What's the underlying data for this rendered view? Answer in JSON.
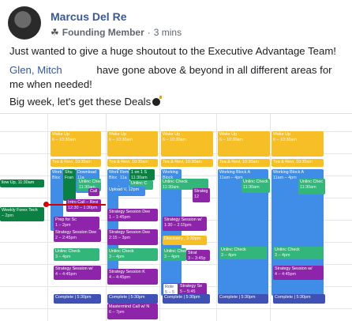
{
  "post": {
    "author": "Marcus Del Re",
    "role": "Founding Member",
    "separator": "·",
    "time": "3 mins",
    "line1": "Just wanted to give a huge shoutout to the Executive Advantage Team!",
    "mention1": "Glen,",
    "mention2": "Mitch",
    "line2a": "have gone above & beyond in all different areas for",
    "line2b": "me when needed!",
    "line3": "Big week, let's get these Deals",
    "icons": {
      "badge": "sprout-icon",
      "emoji": "bomb-icon"
    }
  },
  "calendar": {
    "colors": {
      "yellow": "#f6bf26",
      "blue": "#3f8de6",
      "purple": "#8e24aa",
      "green": "#33b679",
      "navy": "#3f51b5",
      "teal": "#0b8043",
      "now": "#d50000"
    },
    "events": [
      {
        "t": "Wake Up",
        "s": "6 – 10:30am",
        "c": "yellow"
      },
      {
        "t": "Wake Up",
        "s": "6 – 10:30am",
        "c": "yellow"
      },
      {
        "t": "Wake Up",
        "s": "6 – 10:30am",
        "c": "yellow"
      },
      {
        "t": "Wake Up",
        "s": "6 – 10:30am",
        "c": "yellow"
      },
      {
        "t": "Wake Up",
        "s": "6 – 10:30am",
        "c": "yellow"
      },
      {
        "t": "Tea & Revi, 10:30am",
        "s": "",
        "c": "yellow"
      },
      {
        "t": "Tea & Revi, 10:30am",
        "s": "",
        "c": "yellow"
      },
      {
        "t": "Tea & Revi, 10:30am",
        "s": "",
        "c": "yellow"
      },
      {
        "t": "Tea & Revi, 10:30am",
        "s": "",
        "c": "yellow"
      },
      {
        "t": "Tea & Revi, 10:30am",
        "s": "",
        "c": "yellow"
      },
      {
        "t": "llow Up, 11:30am",
        "s": "",
        "c": "teal"
      },
      {
        "t": "Weekly Forex Tech",
        "s": "– 2pm",
        "c": "teal"
      },
      {
        "t": "Work",
        "s": "Bloc",
        "c": "blue"
      },
      {
        "t": "Shu",
        "s": "Fran",
        "c": "teal"
      },
      {
        "t": "Download",
        "s": "11a",
        "c": "blue"
      },
      {
        "t": "Unlinc Chec",
        "s": "11:30am",
        "c": "green"
      },
      {
        "t": "Call",
        "s": "",
        "c": "purple"
      },
      {
        "t": "Intro Call – Revi",
        "s": "12:30 – 1:30pm",
        "c": "purple"
      },
      {
        "t": "Prep for Sc",
        "s": "1 – 2pm",
        "c": "purple"
      },
      {
        "t": "Strategy Session Dee",
        "s": "2 – 2:45pm",
        "c": "purple"
      },
      {
        "t": "Unlinc Check",
        "s": "3 – 4pm",
        "c": "green"
      },
      {
        "t": "Strategy Session w/",
        "s": "4 – 4:45pm",
        "c": "purple"
      },
      {
        "t": "Complete | 5:30pm",
        "s": "",
        "c": "navy"
      },
      {
        "t": "Work",
        "s": "Bloc",
        "c": "blue"
      },
      {
        "t": "Rem",
        "s": "11a",
        "c": "blue"
      },
      {
        "t": "1 on 1 S",
        "s": "11:30am",
        "c": "teal"
      },
      {
        "t": "Unlinc C",
        "s": "11:30",
        "c": "green"
      },
      {
        "t": "Upload V, 12pm",
        "s": "",
        "c": "blue"
      },
      {
        "t": "Strategy Session Dee",
        "s": "1 – 1:45pm",
        "c": "purple"
      },
      {
        "t": "Strategy Session Dee",
        "s": "2:15 – 3pm",
        "c": "purple"
      },
      {
        "t": "Unlinc Check",
        "s": "3 – 4pm",
        "c": "green"
      },
      {
        "t": "Strategy Session K",
        "s": "4 – 4:45pm",
        "c": "purple"
      },
      {
        "t": "Complete | 5:30pm",
        "s": "",
        "c": "navy"
      },
      {
        "t": "Mastermind Call w/ N",
        "s": "6 – 7pm",
        "c": "purple"
      },
      {
        "t": "Working",
        "s": "Block",
        "c": "blue"
      },
      {
        "t": "Unlinc Check",
        "s": "11:30am",
        "c": "green"
      },
      {
        "t": "Strateg",
        "s": "12",
        "c": "purple"
      },
      {
        "t": "Strategy Session w/",
        "s": "1:30 – 2:15pm",
        "c": "purple"
      },
      {
        "t": "Discovery , 2:30pm",
        "s": "",
        "c": "yellow"
      },
      {
        "t": "Unlinc Check",
        "s": "3 – 4pm",
        "c": "green"
      },
      {
        "t": "Strat",
        "s": "3 – 3:45p",
        "c": "purple"
      },
      {
        "t": "Role",
        "s": "5 – 5",
        "c": "white"
      },
      {
        "t": "Strategy Se",
        "s": "5 – 5:45",
        "c": "purple"
      },
      {
        "t": "Complete | 5:30pm",
        "s": "",
        "c": "navy"
      },
      {
        "t": "Working Block A",
        "s": "11am – 4pm",
        "c": "blue"
      },
      {
        "t": "Unlinc Check",
        "s": "11:30am",
        "c": "green"
      },
      {
        "t": "Unlinc Check",
        "s": "3 – 4pm",
        "c": "green"
      },
      {
        "t": "Complete | 5:30pm",
        "s": "",
        "c": "navy"
      },
      {
        "t": "Working Block A",
        "s": "11am – 4pm",
        "c": "blue"
      },
      {
        "t": "Unlinc Chec",
        "s": "11:30am",
        "c": "green"
      },
      {
        "t": "Unlinc Check",
        "s": "3 – 4pm",
        "c": "green"
      },
      {
        "t": "Strategy Session w/",
        "s": "4 – 4:45pm",
        "c": "purple"
      },
      {
        "t": "Complete | 5:30pm",
        "s": "",
        "c": "navy"
      }
    ]
  }
}
